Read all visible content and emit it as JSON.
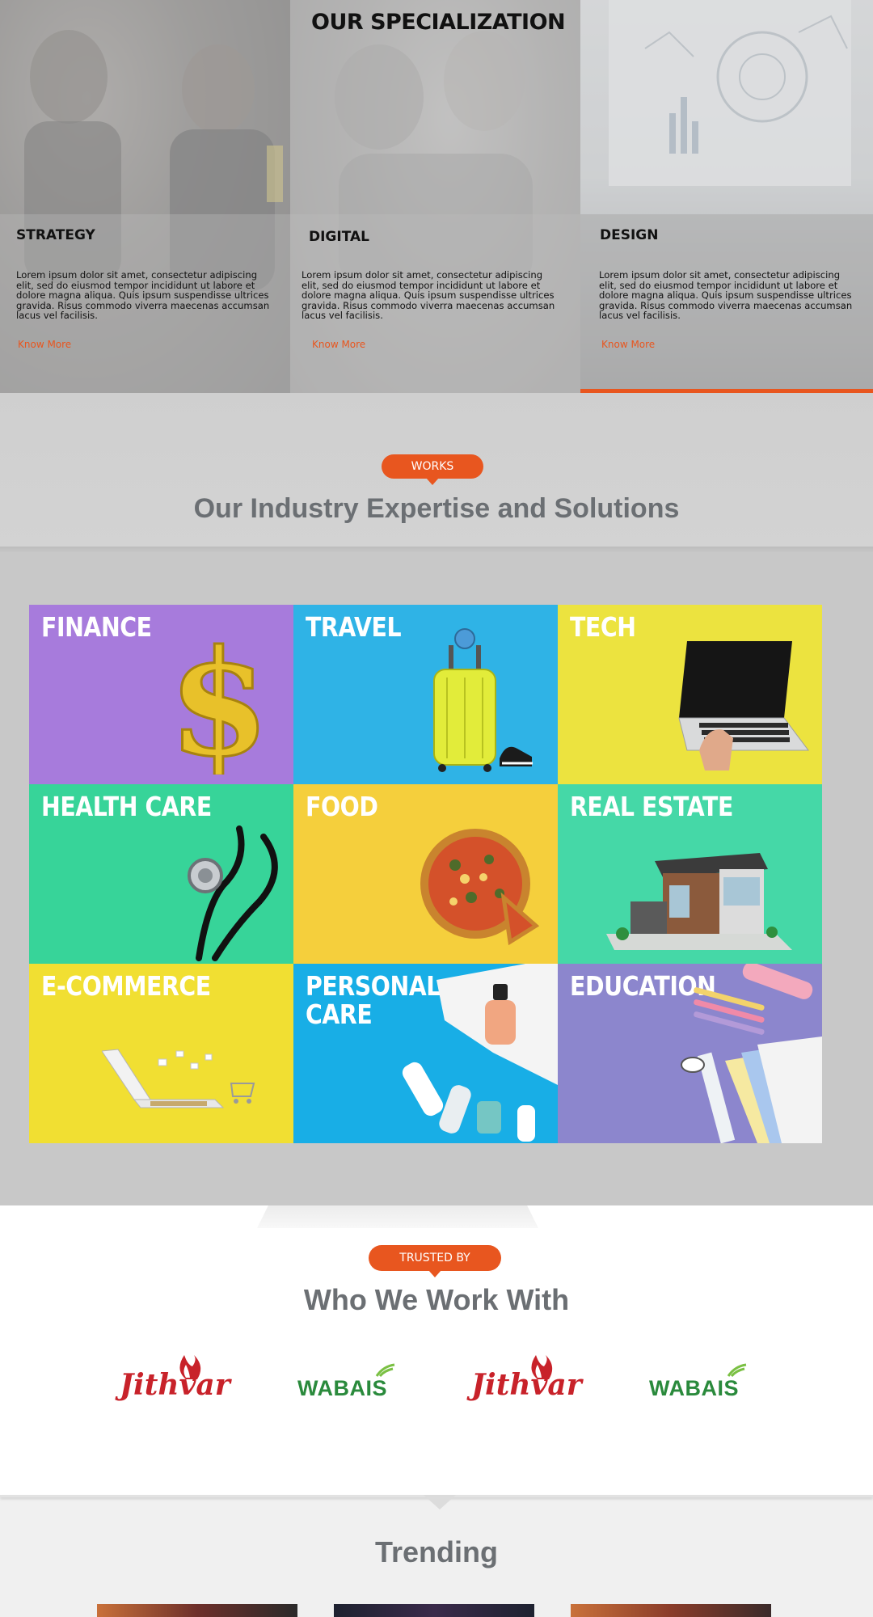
{
  "specialization": {
    "heading": "OUR SPECIALIZATION",
    "cards": [
      {
        "title": "STRATEGY",
        "text": "Lorem ipsum dolor sit amet, consectetur adipiscing elit, sed do eiusmod tempor incididunt ut labore et dolore magna aliqua. Quis ipsum suspendisse ultrices gravida. Risus commodo viverra maecenas accumsan lacus vel facilisis.",
        "link": "Know More"
      },
      {
        "title": "DIGITAL",
        "text": "Lorem ipsum dolor sit amet, consectetur adipiscing elit, sed do eiusmod tempor incididunt ut labore et dolore magna aliqua. Quis ipsum suspendisse ultrices gravida. Risus commodo viverra maecenas accumsan lacus vel facilisis.",
        "link": "Know More"
      },
      {
        "title": "DESIGN",
        "text": "Lorem ipsum dolor sit amet, consectetur adipiscing elit, sed do eiusmod tempor incididunt ut labore et dolore magna aliqua. Quis ipsum suspendisse ultrices gravida. Risus commodo viverra maecenas accumsan lacus vel facilisis.",
        "link": "Know More"
      }
    ]
  },
  "industry": {
    "badge": "WORKS",
    "heading": "Our Industry Expertise and Solutions",
    "tiles": [
      {
        "label": "FINANCE",
        "color": "#a77bdc",
        "icon": "dollar-sign-icon"
      },
      {
        "label": "TRAVEL",
        "color": "#2fb3e6",
        "icon": "suitcase-icon"
      },
      {
        "label": "TECH",
        "color": "#ece33f",
        "icon": "laptop-icon"
      },
      {
        "label": "HEALTH  CARE",
        "color": "#37d499",
        "icon": "stethoscope-icon"
      },
      {
        "label": "FOOD",
        "color": "#f5cf3c",
        "icon": "pizza-icon"
      },
      {
        "label": "REAL ESTATE",
        "color": "#45d8a7",
        "icon": "house-icon"
      },
      {
        "label": "E-COMMERCE",
        "color": "#f1df32",
        "icon": "laptop-cart-icon"
      },
      {
        "label": "PERSONAL\nCARE",
        "color": "#18aee6",
        "icon": "skincare-bottles-icon"
      },
      {
        "label": "EDUCATION",
        "color": "#8c86cd",
        "icon": "stationery-icon"
      }
    ]
  },
  "trusted": {
    "badge": "TRUSTED BY",
    "heading": "Who We Work With",
    "logos": [
      {
        "name": "Jithvar"
      },
      {
        "name": "WABAIS"
      },
      {
        "name": "Jithvar"
      },
      {
        "name": "WABAIS"
      }
    ]
  },
  "trending": {
    "heading": "Trending"
  },
  "colors": {
    "accent": "#e8561f",
    "heading_gray": "#6b6f73"
  }
}
